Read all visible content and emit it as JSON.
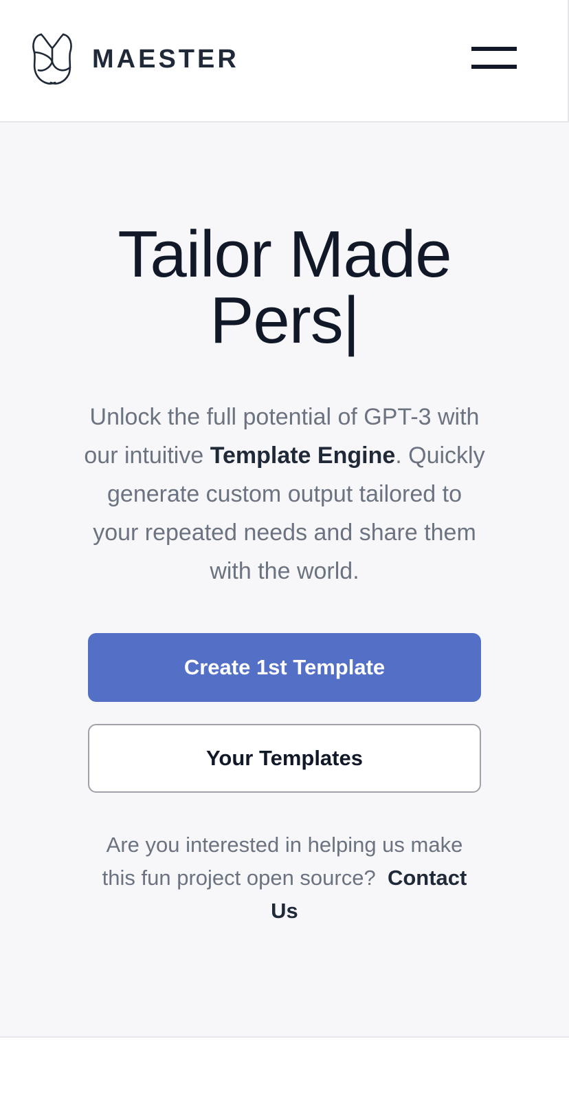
{
  "header": {
    "brand": "MAESTER",
    "logo_icon": "heart-shield-logo-icon",
    "menu_icon": "hamburger-menu-icon"
  },
  "hero": {
    "title_line1": "Tailor Made",
    "title_line2": "Pers",
    "cursor": "|",
    "desc_part1": "Unlock the full potential of GPT-3 with our intuitive ",
    "desc_bold": "Template Engine",
    "desc_part2": ". Quickly generate custom output tailored to your repeated needs and share them with the world."
  },
  "buttons": {
    "primary_label": "Create 1st Template",
    "secondary_label": "Your Templates"
  },
  "contact": {
    "text": "Are you interested in helping us make this fun project open source?",
    "link_label": "Contact Us"
  },
  "colors": {
    "primary": "#5470c6",
    "text_dark": "#111827",
    "text_muted": "#6b7280",
    "main_bg": "#f7f7f9"
  }
}
